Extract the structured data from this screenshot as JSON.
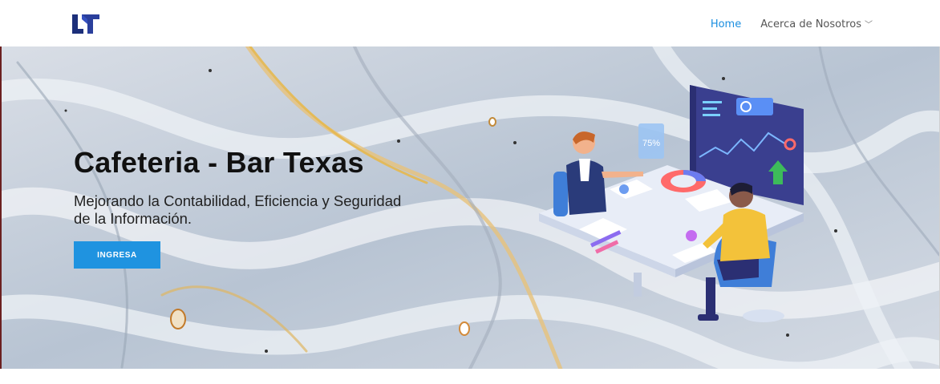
{
  "nav": {
    "links": [
      {
        "label": "Home"
      },
      {
        "label": "Acerca de Nosotros"
      }
    ]
  },
  "hero": {
    "title": "Cafeteria - Bar Texas",
    "subtitle": "Mejorando la Contabilidad, Eficiencia y Seguridad de la Información.",
    "cta_label": "INGRESA",
    "badge_value": "75%"
  },
  "colors": {
    "accent": "#1f93e0",
    "logo": "#1c2f7a",
    "dashboard": "#3a3f8f"
  }
}
